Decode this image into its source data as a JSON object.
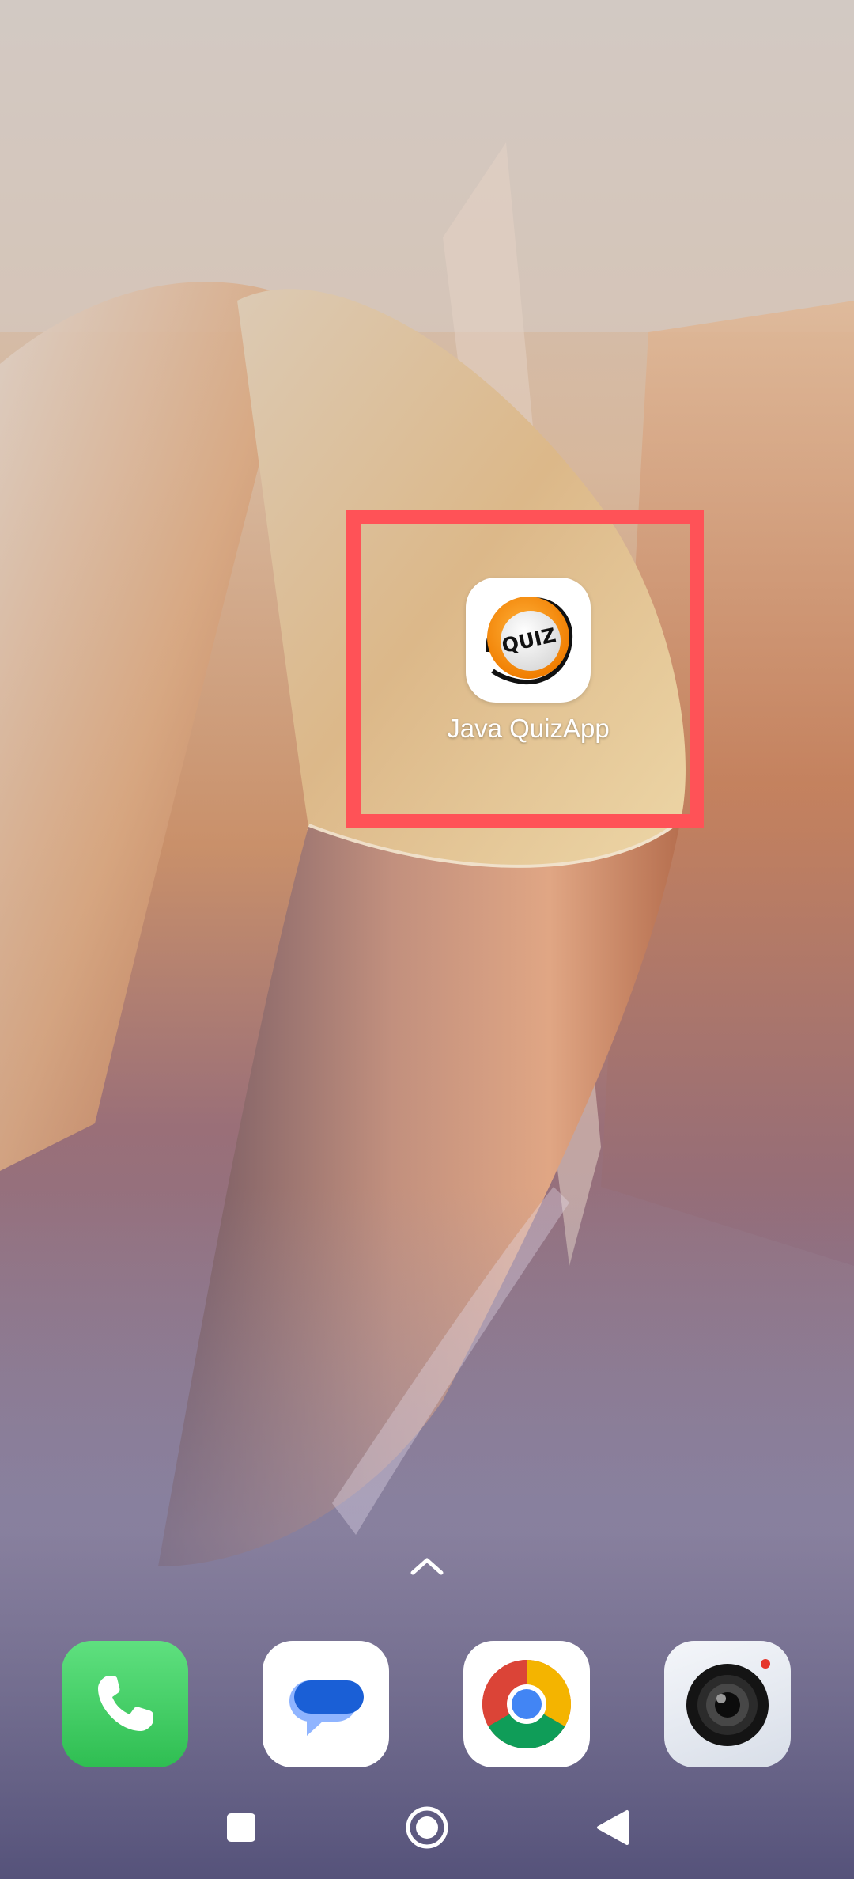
{
  "home_screen": {
    "app_shortcut": {
      "label": "Java QuizApp",
      "icon": "quiz-badge-icon",
      "icon_text": "QUIZ",
      "highlighted": true,
      "highlight_color": "#ff5257"
    },
    "app_drawer_handle": {
      "icon": "chevron-up-icon"
    }
  },
  "dock": {
    "apps": [
      {
        "icon": "phone-icon",
        "color": "#35c759"
      },
      {
        "icon": "messages-icon",
        "color": "#1a5fd6"
      },
      {
        "icon": "chrome-icon",
        "color": "#db4437"
      },
      {
        "icon": "camera-icon",
        "color": "#1c1c1c"
      }
    ]
  },
  "nav_bar": {
    "buttons": [
      {
        "icon": "recents-square-icon"
      },
      {
        "icon": "home-circle-icon"
      },
      {
        "icon": "back-triangle-icon"
      }
    ]
  }
}
